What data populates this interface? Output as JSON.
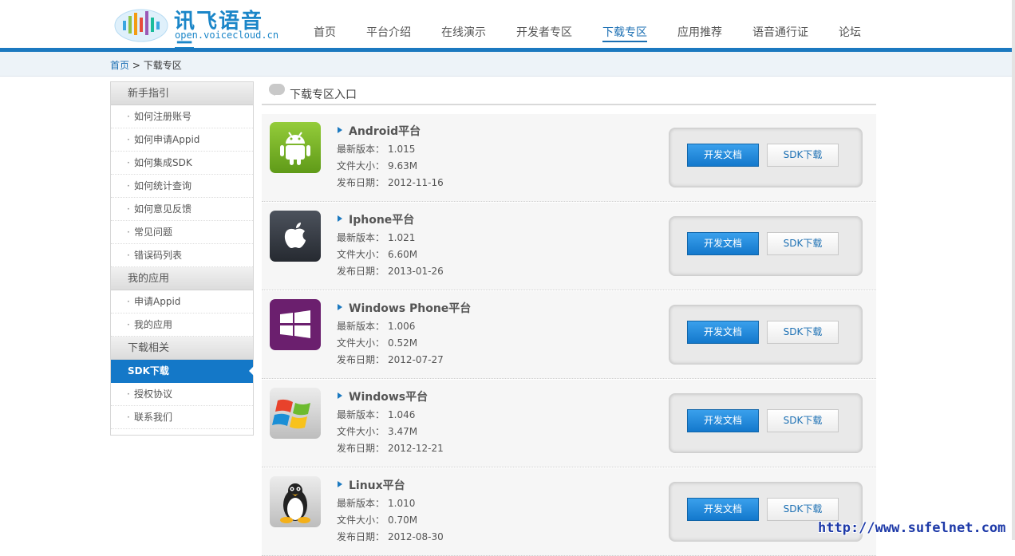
{
  "brand": {
    "name": "讯飞语音云",
    "domain": "open.voicecloud.cn"
  },
  "nav": [
    "首页",
    "平台介绍",
    "在线演示",
    "开发者专区",
    "下载专区",
    "应用推荐",
    "语音通行证",
    "论坛"
  ],
  "nav_active": "下载专区",
  "breadcrumb": {
    "home": "首页",
    "sep": ">",
    "current": "下载专区"
  },
  "sidebar": {
    "groups": [
      {
        "title": "新手指引",
        "items": [
          "如何注册账号",
          "如何申请Appid",
          "如何集成SDK",
          "如何统计查询",
          "如何意见反馈",
          "常见问题",
          "错误码列表"
        ]
      },
      {
        "title": "我的应用",
        "items": [
          "申请Appid",
          "我的应用"
        ]
      },
      {
        "title": "下载相关",
        "items": [
          "SDK下载",
          "授权协议",
          "联系我们"
        ],
        "active": "SDK下载"
      }
    ]
  },
  "section_title": "下载专区入口",
  "labels": {
    "version": "最新版本：",
    "size": "文件大小：",
    "date": "发布日期：",
    "doc_button": "开发文档",
    "sdk_button": "SDK下载"
  },
  "platforms": [
    {
      "name": "Android平台",
      "version": "1.015",
      "size": "9.63M",
      "date": "2012-11-16",
      "icon": "android-icon",
      "color": "#7cb82a"
    },
    {
      "name": "Iphone平台",
      "version": "1.021",
      "size": "6.60M",
      "date": "2013-01-26",
      "icon": "apple-icon",
      "color": "#3a3f47"
    },
    {
      "name": "Windows Phone平台",
      "version": "1.006",
      "size": "0.52M",
      "date": "2012-07-27",
      "icon": "windows-phone-icon",
      "color": "#6b1f6e"
    },
    {
      "name": "Windows平台",
      "version": "1.046",
      "size": "3.47M",
      "date": "2012-12-21",
      "icon": "windows-icon",
      "color": "#d5d5d5"
    },
    {
      "name": "Linux平台",
      "version": "1.010",
      "size": "0.70M",
      "date": "2012-08-30",
      "icon": "linux-tux-icon",
      "color": "#d5d5d5"
    }
  ],
  "watermark": "http://www.sufelnet.com"
}
